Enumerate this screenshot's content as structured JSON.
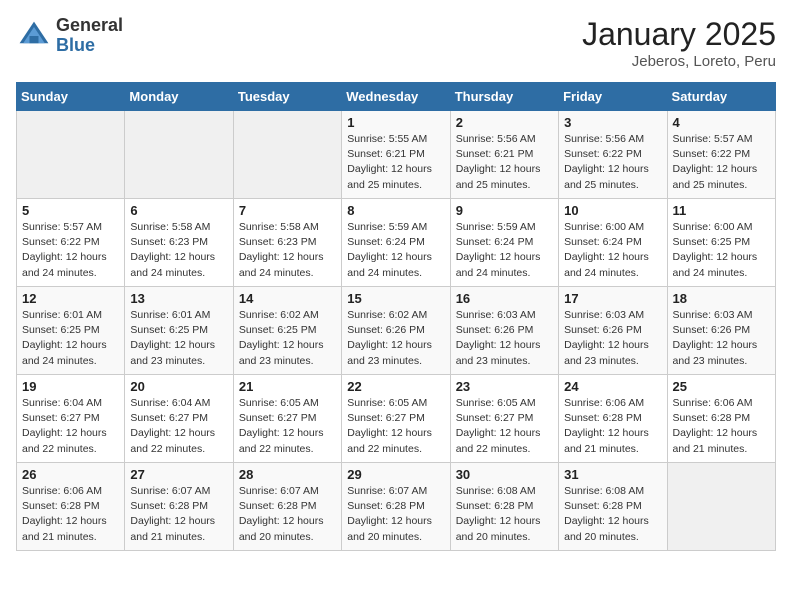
{
  "header": {
    "logo_general": "General",
    "logo_blue": "Blue",
    "title": "January 2025",
    "subtitle": "Jeberos, Loreto, Peru"
  },
  "weekdays": [
    "Sunday",
    "Monday",
    "Tuesday",
    "Wednesday",
    "Thursday",
    "Friday",
    "Saturday"
  ],
  "weeks": [
    [
      {
        "day": "",
        "info": ""
      },
      {
        "day": "",
        "info": ""
      },
      {
        "day": "",
        "info": ""
      },
      {
        "day": "1",
        "info": "Sunrise: 5:55 AM\nSunset: 6:21 PM\nDaylight: 12 hours\nand 25 minutes."
      },
      {
        "day": "2",
        "info": "Sunrise: 5:56 AM\nSunset: 6:21 PM\nDaylight: 12 hours\nand 25 minutes."
      },
      {
        "day": "3",
        "info": "Sunrise: 5:56 AM\nSunset: 6:22 PM\nDaylight: 12 hours\nand 25 minutes."
      },
      {
        "day": "4",
        "info": "Sunrise: 5:57 AM\nSunset: 6:22 PM\nDaylight: 12 hours\nand 25 minutes."
      }
    ],
    [
      {
        "day": "5",
        "info": "Sunrise: 5:57 AM\nSunset: 6:22 PM\nDaylight: 12 hours\nand 24 minutes."
      },
      {
        "day": "6",
        "info": "Sunrise: 5:58 AM\nSunset: 6:23 PM\nDaylight: 12 hours\nand 24 minutes."
      },
      {
        "day": "7",
        "info": "Sunrise: 5:58 AM\nSunset: 6:23 PM\nDaylight: 12 hours\nand 24 minutes."
      },
      {
        "day": "8",
        "info": "Sunrise: 5:59 AM\nSunset: 6:24 PM\nDaylight: 12 hours\nand 24 minutes."
      },
      {
        "day": "9",
        "info": "Sunrise: 5:59 AM\nSunset: 6:24 PM\nDaylight: 12 hours\nand 24 minutes."
      },
      {
        "day": "10",
        "info": "Sunrise: 6:00 AM\nSunset: 6:24 PM\nDaylight: 12 hours\nand 24 minutes."
      },
      {
        "day": "11",
        "info": "Sunrise: 6:00 AM\nSunset: 6:25 PM\nDaylight: 12 hours\nand 24 minutes."
      }
    ],
    [
      {
        "day": "12",
        "info": "Sunrise: 6:01 AM\nSunset: 6:25 PM\nDaylight: 12 hours\nand 24 minutes."
      },
      {
        "day": "13",
        "info": "Sunrise: 6:01 AM\nSunset: 6:25 PM\nDaylight: 12 hours\nand 23 minutes."
      },
      {
        "day": "14",
        "info": "Sunrise: 6:02 AM\nSunset: 6:25 PM\nDaylight: 12 hours\nand 23 minutes."
      },
      {
        "day": "15",
        "info": "Sunrise: 6:02 AM\nSunset: 6:26 PM\nDaylight: 12 hours\nand 23 minutes."
      },
      {
        "day": "16",
        "info": "Sunrise: 6:03 AM\nSunset: 6:26 PM\nDaylight: 12 hours\nand 23 minutes."
      },
      {
        "day": "17",
        "info": "Sunrise: 6:03 AM\nSunset: 6:26 PM\nDaylight: 12 hours\nand 23 minutes."
      },
      {
        "day": "18",
        "info": "Sunrise: 6:03 AM\nSunset: 6:26 PM\nDaylight: 12 hours\nand 23 minutes."
      }
    ],
    [
      {
        "day": "19",
        "info": "Sunrise: 6:04 AM\nSunset: 6:27 PM\nDaylight: 12 hours\nand 22 minutes."
      },
      {
        "day": "20",
        "info": "Sunrise: 6:04 AM\nSunset: 6:27 PM\nDaylight: 12 hours\nand 22 minutes."
      },
      {
        "day": "21",
        "info": "Sunrise: 6:05 AM\nSunset: 6:27 PM\nDaylight: 12 hours\nand 22 minutes."
      },
      {
        "day": "22",
        "info": "Sunrise: 6:05 AM\nSunset: 6:27 PM\nDaylight: 12 hours\nand 22 minutes."
      },
      {
        "day": "23",
        "info": "Sunrise: 6:05 AM\nSunset: 6:27 PM\nDaylight: 12 hours\nand 22 minutes."
      },
      {
        "day": "24",
        "info": "Sunrise: 6:06 AM\nSunset: 6:28 PM\nDaylight: 12 hours\nand 21 minutes."
      },
      {
        "day": "25",
        "info": "Sunrise: 6:06 AM\nSunset: 6:28 PM\nDaylight: 12 hours\nand 21 minutes."
      }
    ],
    [
      {
        "day": "26",
        "info": "Sunrise: 6:06 AM\nSunset: 6:28 PM\nDaylight: 12 hours\nand 21 minutes."
      },
      {
        "day": "27",
        "info": "Sunrise: 6:07 AM\nSunset: 6:28 PM\nDaylight: 12 hours\nand 21 minutes."
      },
      {
        "day": "28",
        "info": "Sunrise: 6:07 AM\nSunset: 6:28 PM\nDaylight: 12 hours\nand 20 minutes."
      },
      {
        "day": "29",
        "info": "Sunrise: 6:07 AM\nSunset: 6:28 PM\nDaylight: 12 hours\nand 20 minutes."
      },
      {
        "day": "30",
        "info": "Sunrise: 6:08 AM\nSunset: 6:28 PM\nDaylight: 12 hours\nand 20 minutes."
      },
      {
        "day": "31",
        "info": "Sunrise: 6:08 AM\nSunset: 6:28 PM\nDaylight: 12 hours\nand 20 minutes."
      },
      {
        "day": "",
        "info": ""
      }
    ]
  ]
}
